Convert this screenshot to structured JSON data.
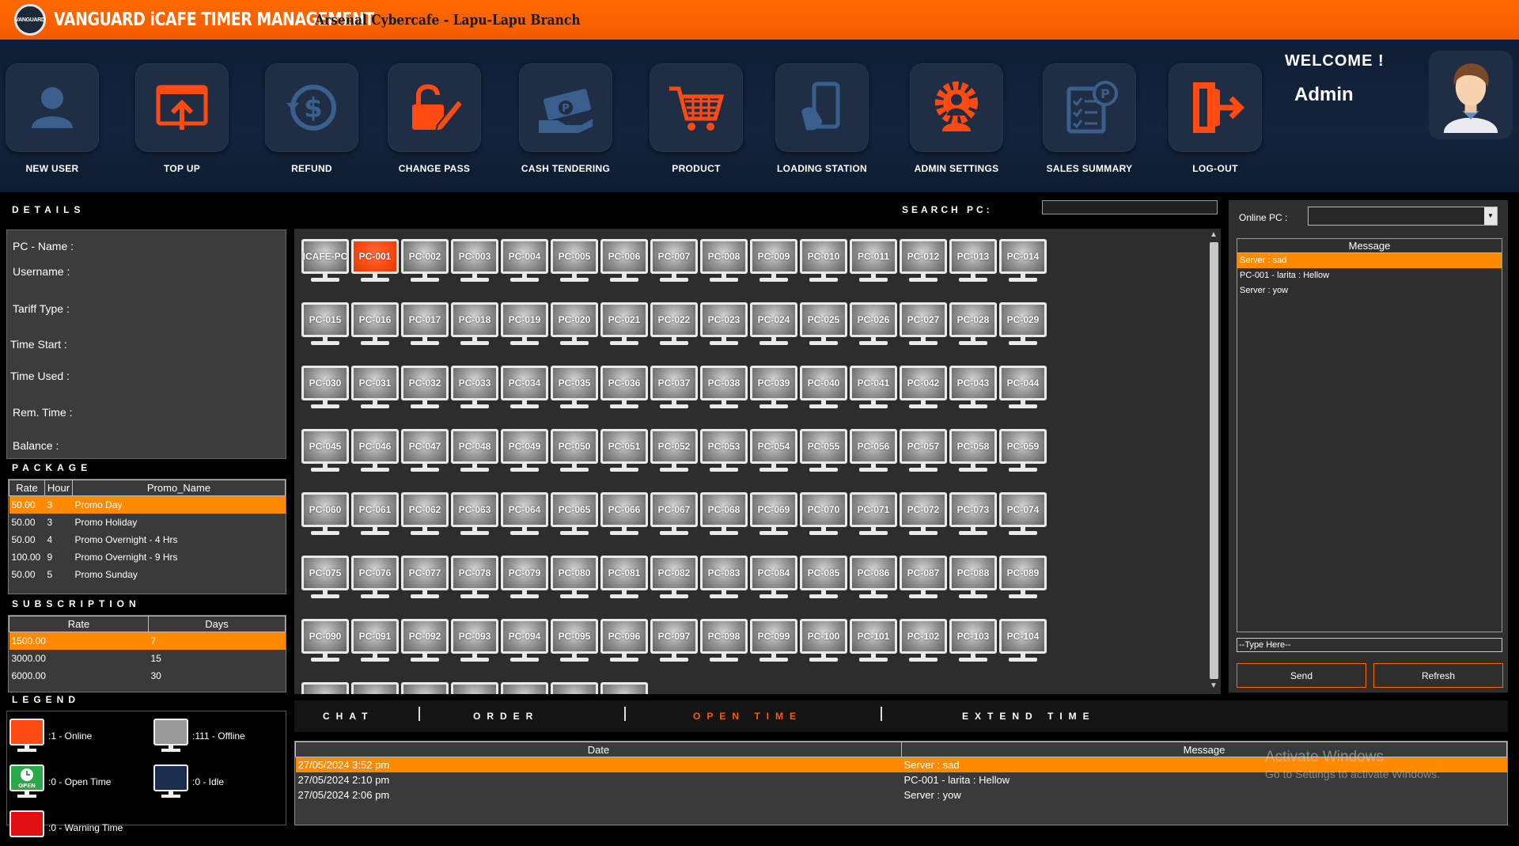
{
  "app": {
    "title": "VANGUARD iCAFE TIMER MANAGEMENT",
    "branch": "Arsenal Cybercafe - Lapu-Lapu Branch",
    "logo_text": "VANGUARD"
  },
  "toolbar": {
    "new_user": "NEW USER",
    "top_up": "TOP UP",
    "refund": "REFUND",
    "change_pass": "CHANGE  PASS",
    "cash_tendering": "CASH TENDERING",
    "product": "PRODUCT",
    "loading_station": "LOADING STATION",
    "admin_settings": "ADMIN SETTINGS",
    "sales_summary": "SALES SUMMARY",
    "log_out": "LOG-OUT"
  },
  "welcome": {
    "greeting": "WELCOME !",
    "user": "Admin"
  },
  "details": {
    "heading": "DETAILS",
    "pc_name": "PC - Name  :",
    "username": "Username  :",
    "tariff_type": "Tariff Type  :",
    "time_start": "Time Start  :",
    "time_used": "Time Used  :",
    "rem_time": "Rem. Time  :",
    "balance": "Balance  :"
  },
  "package": {
    "heading": "PACKAGE",
    "columns": [
      "Rate",
      "Hour",
      "Promo_Name"
    ],
    "rows": [
      [
        "50.00",
        "3",
        "Promo Day"
      ],
      [
        "50.00",
        "3",
        "Promo Holiday"
      ],
      [
        "50.00",
        "4",
        "Promo Overnight - 4 Hrs"
      ],
      [
        "100.00",
        "9",
        "Promo Overnight - 9 Hrs"
      ],
      [
        "50.00",
        "5",
        "Promo Sunday"
      ]
    ]
  },
  "subscription": {
    "heading": "SUBSCRIPTION",
    "columns": [
      "Rate",
      "Days"
    ],
    "rows": [
      [
        "1500.00",
        "7"
      ],
      [
        "3000.00",
        "15"
      ],
      [
        "6000.00",
        "30"
      ]
    ]
  },
  "legend": {
    "heading": "LEGEND",
    "online": ":1 - Online",
    "offline": ":111 - Offline",
    "open_time": ":0 - Open Time",
    "idle": ":0 - Idle",
    "warning": ":0 - Warning Time",
    "open_badge": "OPEN",
    "colors": {
      "online": "#ff4a12",
      "offline": "#9a9a9a",
      "open_time": "#2ba84a",
      "idle": "#1b2d4d",
      "warning": "#e01010"
    }
  },
  "search": {
    "label": "SEARCH PC:",
    "value": ""
  },
  "pcs": {
    "online": [
      "PC-001"
    ],
    "names": [
      "ICAFE-PC",
      "PC-001",
      "PC-002",
      "PC-003",
      "PC-004",
      "PC-005",
      "PC-006",
      "PC-007",
      "PC-008",
      "PC-009",
      "PC-010",
      "PC-011",
      "PC-012",
      "PC-013",
      "PC-014",
      "PC-015",
      "PC-016",
      "PC-017",
      "PC-018",
      "PC-019",
      "PC-020",
      "PC-021",
      "PC-022",
      "PC-023",
      "PC-024",
      "PC-025",
      "PC-026",
      "PC-027",
      "PC-028",
      "PC-029",
      "PC-030",
      "PC-031",
      "PC-032",
      "PC-033",
      "PC-034",
      "PC-035",
      "PC-036",
      "PC-037",
      "PC-038",
      "PC-039",
      "PC-040",
      "PC-041",
      "PC-042",
      "PC-043",
      "PC-044",
      "PC-045",
      "PC-046",
      "PC-047",
      "PC-048",
      "PC-049",
      "PC-050",
      "PC-051",
      "PC-052",
      "PC-053",
      "PC-054",
      "PC-055",
      "PC-056",
      "PC-057",
      "PC-058",
      "PC-059",
      "PC-060",
      "PC-061",
      "PC-062",
      "PC-063",
      "PC-064",
      "PC-065",
      "PC-066",
      "PC-067",
      "PC-068",
      "PC-069",
      "PC-070",
      "PC-071",
      "PC-072",
      "PC-073",
      "PC-074",
      "PC-075",
      "PC-076",
      "PC-077",
      "PC-078",
      "PC-079",
      "PC-080",
      "PC-081",
      "PC-082",
      "PC-083",
      "PC-084",
      "PC-085",
      "PC-086",
      "PC-087",
      "PC-088",
      "PC-089",
      "PC-090",
      "PC-091",
      "PC-092",
      "PC-093",
      "PC-094",
      "PC-095",
      "PC-096",
      "PC-097",
      "PC-098",
      "PC-099",
      "PC-100",
      "PC-101",
      "PC-102",
      "PC-103",
      "PC-104"
    ]
  },
  "tabs": {
    "chat": "CHAT",
    "order": "ORDER",
    "open_time": "OPEN TIME",
    "extend_time": "EXTEND TIME"
  },
  "log": {
    "columns": [
      "Date",
      "Message"
    ],
    "rows": [
      [
        "27/05/2024 3:52 pm",
        "Server : sad"
      ],
      [
        "27/05/2024 2:10 pm",
        "PC-001 - larita : Hellow"
      ],
      [
        "27/05/2024 2:06 pm",
        "Server : yow"
      ]
    ]
  },
  "chat": {
    "online_label": "Online PC :",
    "online_value": "",
    "message_header": "Message",
    "messages": [
      "Server : sad",
      "PC-001 - larita : Hellow",
      "Server : yow"
    ],
    "input_value": "--Type Here--",
    "send": "Send",
    "refresh": "Refresh"
  },
  "watermark": {
    "line1": "Activate Windows",
    "line2": "Go to Settings to activate Windows."
  },
  "colors": {
    "accent": "#ff6a00",
    "selection": "#ff8a00",
    "toolbar_bg": "#13243d"
  }
}
